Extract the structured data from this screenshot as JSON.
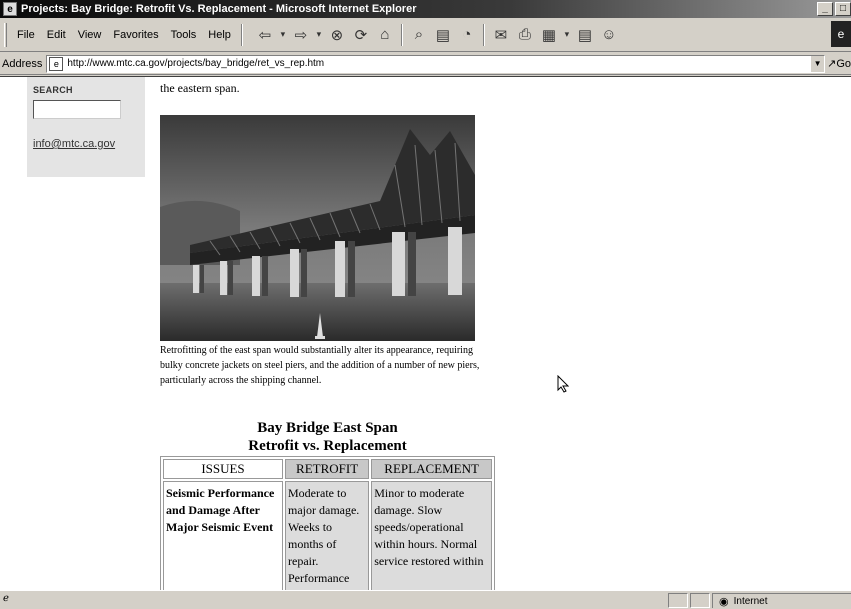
{
  "window": {
    "title": "Projects: Bay Bridge: Retrofit Vs. Replacement - Microsoft Internet Explorer",
    "buttons": [
      "_",
      "□"
    ]
  },
  "menu": {
    "items": [
      "File",
      "Edit",
      "View",
      "Favorites",
      "Tools",
      "Help"
    ]
  },
  "toolbar": {
    "icons": [
      "back-icon",
      "forward-icon",
      "stop-icon",
      "refresh-icon",
      "home-icon",
      "search-icon",
      "favorites-icon",
      "history-icon",
      "mail-icon",
      "print-icon",
      "edit-icon",
      "discuss-icon",
      "messenger-icon"
    ]
  },
  "address": {
    "label": "Address",
    "url": "http://www.mtc.ca.gov/projects/bay_bridge/ret_vs_rep.htm",
    "go_label": "Go"
  },
  "sidebar": {
    "search_label": "SEARCH",
    "search_value": "",
    "email": "info@mtc.ca.gov"
  },
  "content": {
    "lead": "the eastern span.",
    "photo_subject": "bridge-photo",
    "caption": "Retrofitting of the east span would substantially alter its appearance, requiring bulky concrete jackets on steel piers, and the addition of a number of new piers, particularly across the shipping channel.",
    "table_title_1": "Bay Bridge East Span",
    "table_title_2": "Retrofit vs. Replacement",
    "table": {
      "headers": [
        "ISSUES",
        "RETROFIT",
        "REPLACEMENT"
      ],
      "rows": [
        {
          "issue": "Seismic Performance and Damage After Major Seismic Event",
          "retrofit": "Moderate to major damage. Weeks to months of repair. Performance",
          "replacement": "Minor to moderate damage. Slow speeds/operational within hours. Normal service restored within"
        }
      ]
    }
  },
  "status": {
    "zone": "Internet"
  }
}
